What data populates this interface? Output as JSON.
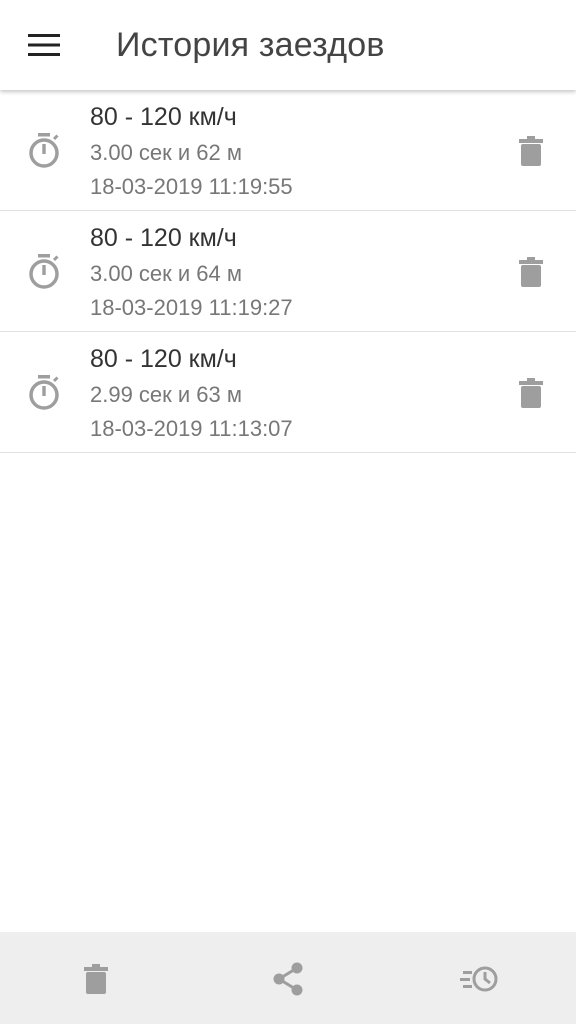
{
  "app_bar": {
    "title": "История заездов",
    "menu_icon": "hamburger-menu-icon"
  },
  "runs": [
    {
      "title": "80 - 120 км/ч",
      "result": "3.00 сек и 62 м",
      "timestamp": "18-03-2019 11:19:55",
      "icon": "stopwatch-icon",
      "action_icon": "trash-icon"
    },
    {
      "title": "80 - 120 км/ч",
      "result": "3.00 сек и 64 м",
      "timestamp": "18-03-2019 11:19:27",
      "icon": "stopwatch-icon",
      "action_icon": "trash-icon"
    },
    {
      "title": "80 - 120 км/ч",
      "result": "2.99 сек и 63 м",
      "timestamp": "18-03-2019 11:13:07",
      "icon": "stopwatch-icon",
      "action_icon": "trash-icon"
    }
  ],
  "bottom_bar": {
    "actions": [
      "trash-icon",
      "share-icon",
      "history-icon"
    ]
  },
  "colors": {
    "icon_gray": "#9e9e9e",
    "title_text": "#333333",
    "secondary_text": "#777777",
    "bottom_bar_bg": "#eeeeee",
    "divider": "#e2e2e2"
  }
}
